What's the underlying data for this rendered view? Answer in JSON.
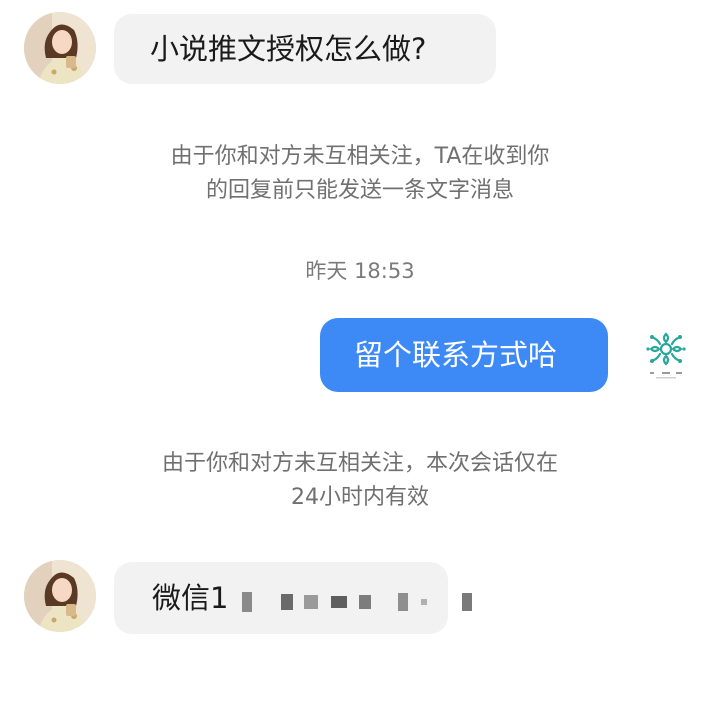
{
  "messages": {
    "first_incoming": "小说推文授权怎么做?",
    "system_notice_1": {
      "line1": "由于你和对方未互相关注，TA在收到你",
      "line2": "的回复前只能发送一条文字消息"
    },
    "timestamp": "昨天 18:53",
    "outgoing": "留个联系方式哈",
    "system_notice_2": {
      "line1": "由于你和对方未互相关注，本次会话仅在",
      "line2": "24小时内有效"
    },
    "second_incoming_prefix": "微信1"
  },
  "icons": {
    "self_avatar": "watermark-logo-icon",
    "peer_avatar": "user-avatar"
  },
  "colors": {
    "outgoing_bubble": "#3d8af7",
    "incoming_bubble": "#f2f2f2",
    "system_text": "#707070",
    "logo_teal": "#2aa79b"
  }
}
